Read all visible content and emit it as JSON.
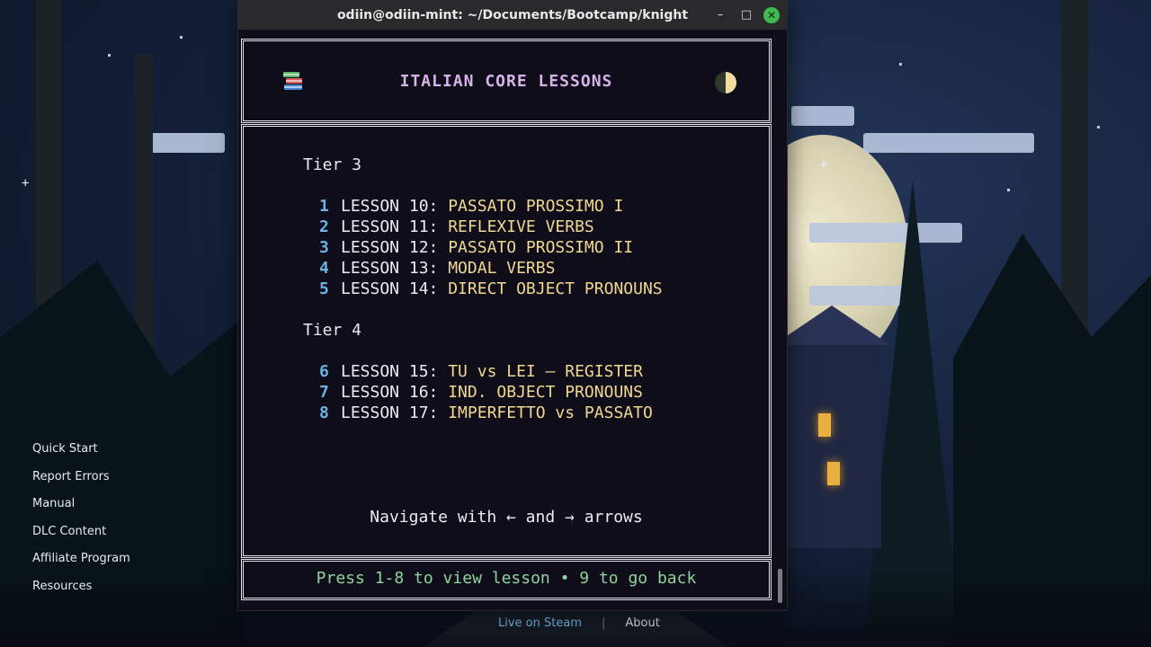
{
  "window": {
    "title": "odiin@odiin-mint: ~/Documents/Bootcamp/knight",
    "minimize_glyph": "–",
    "maximize_glyph": "□",
    "close_glyph": "✕"
  },
  "app": {
    "title": "ITALIAN CORE LESSONS",
    "left_icon": "books-icon",
    "right_icon": "half-moon-theme-icon"
  },
  "tiers": [
    {
      "label": "Tier 3",
      "lessons": [
        {
          "num": "1",
          "label": "LESSON 10: ",
          "name": "PASSATO PROSSIMO I"
        },
        {
          "num": "2",
          "label": "LESSON 11: ",
          "name": "REFLEXIVE VERBS"
        },
        {
          "num": "3",
          "label": "LESSON 12: ",
          "name": "PASSATO PROSSIMO II"
        },
        {
          "num": "4",
          "label": "LESSON 13: ",
          "name": "MODAL VERBS"
        },
        {
          "num": "5",
          "label": "LESSON 14: ",
          "name": "DIRECT OBJECT PRONOUNS"
        }
      ]
    },
    {
      "label": "Tier 4",
      "lessons": [
        {
          "num": "6",
          "label": "LESSON 15: ",
          "name": "TU vs LEI – REGISTER"
        },
        {
          "num": "7",
          "label": "LESSON 16: ",
          "name": "IND. OBJECT PRONOUNS"
        },
        {
          "num": "8",
          "label": "LESSON 17: ",
          "name": "IMPERFETTO vs PASSATO"
        }
      ]
    }
  ],
  "nav_hint": "Navigate with ← and → arrows",
  "footer_prompt": "Press 1-8 to view lesson • 9 to go back",
  "desktop_menu": [
    "Quick Start",
    "Report Errors",
    "Manual",
    "DLC Content",
    "Affiliate Program",
    "Resources"
  ],
  "desktop_footer": {
    "steam": "Live on Steam",
    "about": "About"
  },
  "colors": {
    "terminal_bg": "#0f0d1a",
    "title_purple": "#d4b4e6",
    "number_blue": "#6cb2e0",
    "lesson_yellow": "#f0d890",
    "prompt_green": "#8fd49b",
    "close_green": "#3fb950"
  }
}
